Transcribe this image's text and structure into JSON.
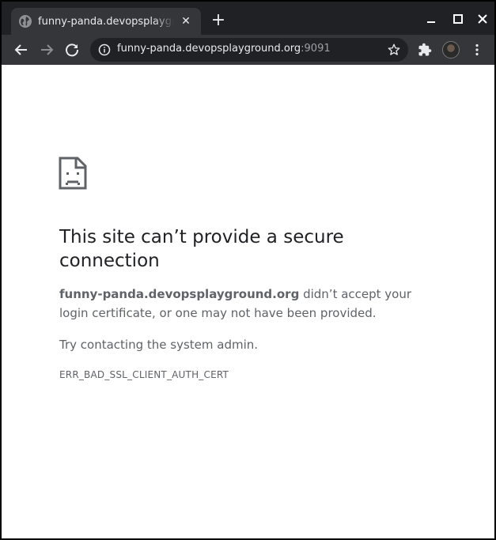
{
  "browser": {
    "tab": {
      "title": "funny-panda.devopsplayground.org",
      "close_glyph": "✕",
      "favicon": "globe-icon"
    },
    "new_tab_glyph": "+",
    "address": {
      "host": "funny-panda.devopsplayground.org",
      "port": ":9091"
    }
  },
  "error_page": {
    "heading": "This site can’t provide a secure connection",
    "host": "funny-panda.devopsplayground.org",
    "message_rest": " didn’t accept your login certificate, or one may not have been provided.",
    "suggestion": "Try contacting the system admin.",
    "error_code": "ERR_BAD_SSL_CLIENT_AUTH_CERT"
  },
  "colors": {
    "frame": "#202124",
    "toolbar": "#35363a",
    "text_primary": "#202124",
    "text_secondary": "#5f6368"
  }
}
